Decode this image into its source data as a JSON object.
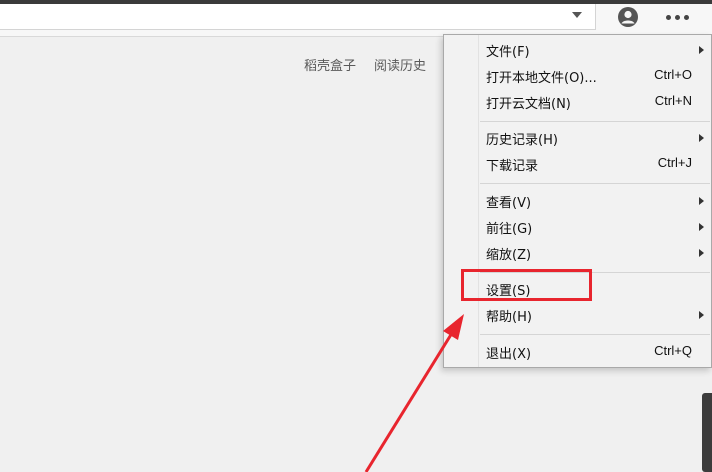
{
  "toolbar": {
    "avatar_icon": "user-avatar-icon",
    "more_icon": "more-dots-icon"
  },
  "links": [
    "稻壳盒子",
    "阅读历史"
  ],
  "menu": {
    "items": [
      {
        "label": "文件(F)",
        "shortcut": "",
        "submenu": true
      },
      {
        "label": "打开本地文件(O)...",
        "shortcut": "Ctrl+O",
        "submenu": false
      },
      {
        "label": "打开云文档(N)",
        "shortcut": "Ctrl+N",
        "submenu": false
      },
      {
        "label": "历史记录(H)",
        "shortcut": "",
        "submenu": true
      },
      {
        "label": "下载记录",
        "shortcut": "Ctrl+J",
        "submenu": false
      },
      {
        "label": "查看(V)",
        "shortcut": "",
        "submenu": true
      },
      {
        "label": "前往(G)",
        "shortcut": "",
        "submenu": true
      },
      {
        "label": "缩放(Z)",
        "shortcut": "",
        "submenu": true
      },
      {
        "label": "设置(S)",
        "shortcut": "",
        "submenu": false
      },
      {
        "label": "帮助(H)",
        "shortcut": "",
        "submenu": true
      },
      {
        "label": "退出(X)",
        "shortcut": "Ctrl+Q",
        "submenu": false
      }
    ]
  },
  "annotation": {
    "highlight_color": "#e8252e",
    "highlighted_item": "设置(S)"
  }
}
